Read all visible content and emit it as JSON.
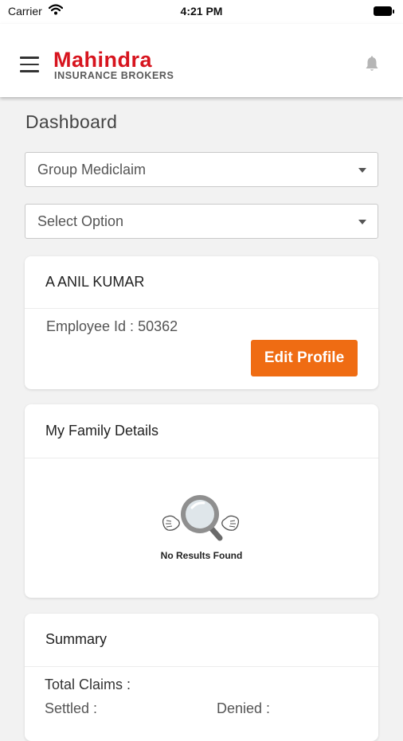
{
  "status_bar": {
    "carrier": "Carrier",
    "time": "4:21 PM"
  },
  "header": {
    "logo_brand": "Mahindra",
    "logo_sub": "INSURANCE BROKERS",
    "brand_color": "#d7141e"
  },
  "main": {
    "title": "Dashboard",
    "policy_select": {
      "value": "Group Mediclaim"
    },
    "option_select": {
      "value": "Select Option"
    }
  },
  "profile_card": {
    "name": "A ANIL KUMAR",
    "employee_id_label": "Employee Id :",
    "employee_id_value": "50362",
    "edit_button": "Edit Profile",
    "accent_color": "#ef6c13"
  },
  "family_card": {
    "title": "My Family Details",
    "empty_message": "No Results Found"
  },
  "summary_card": {
    "title": "Summary",
    "total_claims_label": "Total Claims :",
    "settled_label": "Settled :",
    "denied_label": "Denied :"
  }
}
